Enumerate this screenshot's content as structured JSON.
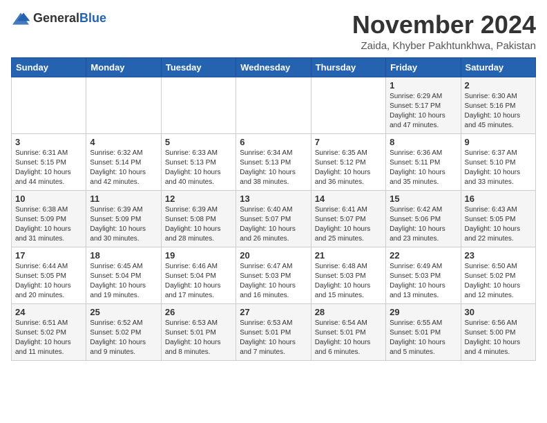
{
  "header": {
    "logo_general": "General",
    "logo_blue": "Blue",
    "month": "November 2024",
    "location": "Zaida, Khyber Pakhtunkhwa, Pakistan"
  },
  "weekdays": [
    "Sunday",
    "Monday",
    "Tuesday",
    "Wednesday",
    "Thursday",
    "Friday",
    "Saturday"
  ],
  "weeks": [
    [
      {
        "day": "",
        "sunrise": "",
        "sunset": "",
        "daylight": ""
      },
      {
        "day": "",
        "sunrise": "",
        "sunset": "",
        "daylight": ""
      },
      {
        "day": "",
        "sunrise": "",
        "sunset": "",
        "daylight": ""
      },
      {
        "day": "",
        "sunrise": "",
        "sunset": "",
        "daylight": ""
      },
      {
        "day": "",
        "sunrise": "",
        "sunset": "",
        "daylight": ""
      },
      {
        "day": "1",
        "sunrise": "Sunrise: 6:29 AM",
        "sunset": "Sunset: 5:17 PM",
        "daylight": "Daylight: 10 hours and 47 minutes."
      },
      {
        "day": "2",
        "sunrise": "Sunrise: 6:30 AM",
        "sunset": "Sunset: 5:16 PM",
        "daylight": "Daylight: 10 hours and 45 minutes."
      }
    ],
    [
      {
        "day": "3",
        "sunrise": "Sunrise: 6:31 AM",
        "sunset": "Sunset: 5:15 PM",
        "daylight": "Daylight: 10 hours and 44 minutes."
      },
      {
        "day": "4",
        "sunrise": "Sunrise: 6:32 AM",
        "sunset": "Sunset: 5:14 PM",
        "daylight": "Daylight: 10 hours and 42 minutes."
      },
      {
        "day": "5",
        "sunrise": "Sunrise: 6:33 AM",
        "sunset": "Sunset: 5:13 PM",
        "daylight": "Daylight: 10 hours and 40 minutes."
      },
      {
        "day": "6",
        "sunrise": "Sunrise: 6:34 AM",
        "sunset": "Sunset: 5:13 PM",
        "daylight": "Daylight: 10 hours and 38 minutes."
      },
      {
        "day": "7",
        "sunrise": "Sunrise: 6:35 AM",
        "sunset": "Sunset: 5:12 PM",
        "daylight": "Daylight: 10 hours and 36 minutes."
      },
      {
        "day": "8",
        "sunrise": "Sunrise: 6:36 AM",
        "sunset": "Sunset: 5:11 PM",
        "daylight": "Daylight: 10 hours and 35 minutes."
      },
      {
        "day": "9",
        "sunrise": "Sunrise: 6:37 AM",
        "sunset": "Sunset: 5:10 PM",
        "daylight": "Daylight: 10 hours and 33 minutes."
      }
    ],
    [
      {
        "day": "10",
        "sunrise": "Sunrise: 6:38 AM",
        "sunset": "Sunset: 5:09 PM",
        "daylight": "Daylight: 10 hours and 31 minutes."
      },
      {
        "day": "11",
        "sunrise": "Sunrise: 6:39 AM",
        "sunset": "Sunset: 5:09 PM",
        "daylight": "Daylight: 10 hours and 30 minutes."
      },
      {
        "day": "12",
        "sunrise": "Sunrise: 6:39 AM",
        "sunset": "Sunset: 5:08 PM",
        "daylight": "Daylight: 10 hours and 28 minutes."
      },
      {
        "day": "13",
        "sunrise": "Sunrise: 6:40 AM",
        "sunset": "Sunset: 5:07 PM",
        "daylight": "Daylight: 10 hours and 26 minutes."
      },
      {
        "day": "14",
        "sunrise": "Sunrise: 6:41 AM",
        "sunset": "Sunset: 5:07 PM",
        "daylight": "Daylight: 10 hours and 25 minutes."
      },
      {
        "day": "15",
        "sunrise": "Sunrise: 6:42 AM",
        "sunset": "Sunset: 5:06 PM",
        "daylight": "Daylight: 10 hours and 23 minutes."
      },
      {
        "day": "16",
        "sunrise": "Sunrise: 6:43 AM",
        "sunset": "Sunset: 5:05 PM",
        "daylight": "Daylight: 10 hours and 22 minutes."
      }
    ],
    [
      {
        "day": "17",
        "sunrise": "Sunrise: 6:44 AM",
        "sunset": "Sunset: 5:05 PM",
        "daylight": "Daylight: 10 hours and 20 minutes."
      },
      {
        "day": "18",
        "sunrise": "Sunrise: 6:45 AM",
        "sunset": "Sunset: 5:04 PM",
        "daylight": "Daylight: 10 hours and 19 minutes."
      },
      {
        "day": "19",
        "sunrise": "Sunrise: 6:46 AM",
        "sunset": "Sunset: 5:04 PM",
        "daylight": "Daylight: 10 hours and 17 minutes."
      },
      {
        "day": "20",
        "sunrise": "Sunrise: 6:47 AM",
        "sunset": "Sunset: 5:03 PM",
        "daylight": "Daylight: 10 hours and 16 minutes."
      },
      {
        "day": "21",
        "sunrise": "Sunrise: 6:48 AM",
        "sunset": "Sunset: 5:03 PM",
        "daylight": "Daylight: 10 hours and 15 minutes."
      },
      {
        "day": "22",
        "sunrise": "Sunrise: 6:49 AM",
        "sunset": "Sunset: 5:03 PM",
        "daylight": "Daylight: 10 hours and 13 minutes."
      },
      {
        "day": "23",
        "sunrise": "Sunrise: 6:50 AM",
        "sunset": "Sunset: 5:02 PM",
        "daylight": "Daylight: 10 hours and 12 minutes."
      }
    ],
    [
      {
        "day": "24",
        "sunrise": "Sunrise: 6:51 AM",
        "sunset": "Sunset: 5:02 PM",
        "daylight": "Daylight: 10 hours and 11 minutes."
      },
      {
        "day": "25",
        "sunrise": "Sunrise: 6:52 AM",
        "sunset": "Sunset: 5:02 PM",
        "daylight": "Daylight: 10 hours and 9 minutes."
      },
      {
        "day": "26",
        "sunrise": "Sunrise: 6:53 AM",
        "sunset": "Sunset: 5:01 PM",
        "daylight": "Daylight: 10 hours and 8 minutes."
      },
      {
        "day": "27",
        "sunrise": "Sunrise: 6:53 AM",
        "sunset": "Sunset: 5:01 PM",
        "daylight": "Daylight: 10 hours and 7 minutes."
      },
      {
        "day": "28",
        "sunrise": "Sunrise: 6:54 AM",
        "sunset": "Sunset: 5:01 PM",
        "daylight": "Daylight: 10 hours and 6 minutes."
      },
      {
        "day": "29",
        "sunrise": "Sunrise: 6:55 AM",
        "sunset": "Sunset: 5:01 PM",
        "daylight": "Daylight: 10 hours and 5 minutes."
      },
      {
        "day": "30",
        "sunrise": "Sunrise: 6:56 AM",
        "sunset": "Sunset: 5:00 PM",
        "daylight": "Daylight: 10 hours and 4 minutes."
      }
    ]
  ]
}
